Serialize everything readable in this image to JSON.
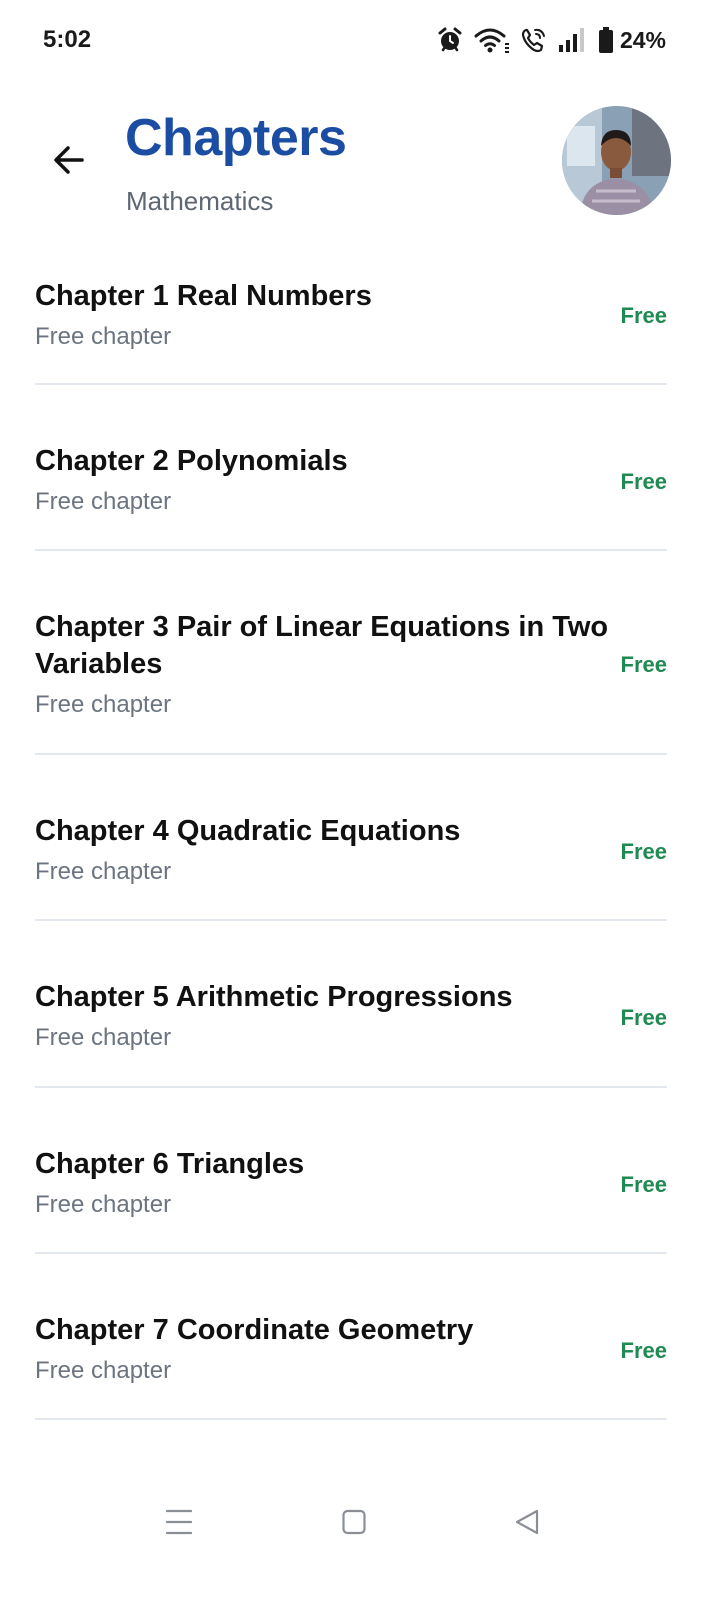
{
  "status_bar": {
    "time": "5:02",
    "battery": "24%",
    "icons": [
      "alarm-icon",
      "wifi-icon",
      "wifi-call-icon",
      "signal-icon",
      "battery-icon"
    ]
  },
  "header": {
    "title": "Chapters",
    "subtitle": "Mathematics",
    "back_icon": "arrow-left-icon",
    "avatar_icon": "user-avatar"
  },
  "chapters": [
    {
      "title": "Chapter 1 Real Numbers",
      "subtitle": "Free chapter",
      "badge": "Free"
    },
    {
      "title": "Chapter 2 Polynomials",
      "subtitle": "Free chapter",
      "badge": "Free"
    },
    {
      "title": "Chapter 3 Pair of Linear Equations in Two Variables",
      "subtitle": "Free chapter",
      "badge": "Free"
    },
    {
      "title": "Chapter 4 Quadratic Equations",
      "subtitle": "Free chapter",
      "badge": "Free"
    },
    {
      "title": "Chapter 5 Arithmetic Progressions",
      "subtitle": "Free chapter",
      "badge": "Free"
    },
    {
      "title": "Chapter 6 Triangles",
      "subtitle": "Free chapter",
      "badge": "Free"
    },
    {
      "title": "Chapter 7 Coordinate Geometry",
      "subtitle": "Free chapter",
      "badge": "Free"
    }
  ],
  "nav_bar": {
    "icons": [
      "menu-icon",
      "home-square-icon",
      "back-triangle-icon"
    ]
  },
  "colors": {
    "title": "#1b4da3",
    "badge": "#1f8a52",
    "divider": "#e3e8ee",
    "subtitle": "#5d6673"
  }
}
